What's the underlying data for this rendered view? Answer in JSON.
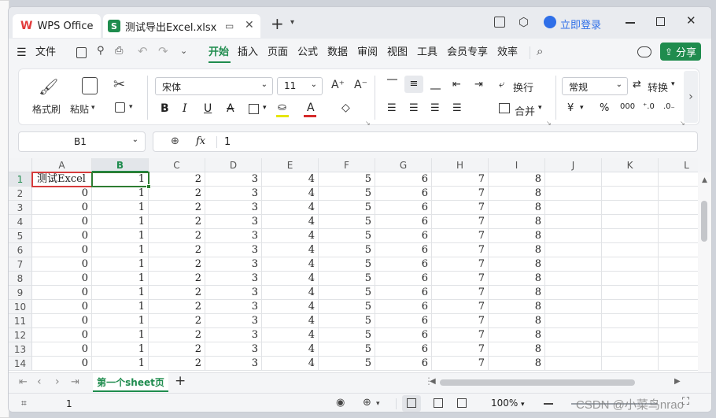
{
  "tabs": [
    {
      "label": "WPS Office"
    },
    {
      "label": "测试导出Excel.xlsx"
    }
  ],
  "window": {
    "login_label": "立即登录"
  },
  "menu": {
    "items": [
      "文件",
      "开始",
      "插入",
      "页面",
      "公式",
      "数据",
      "审阅",
      "视图",
      "工具",
      "会员专享",
      "效率"
    ],
    "active": "开始",
    "share_label": "分享"
  },
  "ribbon": {
    "format_painter": "格式刷",
    "paste": "粘贴",
    "font_name": "宋体",
    "font_size": "11",
    "wrap": "换行",
    "merge": "合并",
    "number_format": "常规",
    "convert": "转换",
    "bold": "B",
    "italic": "I",
    "underline": "U",
    "strike": "A",
    "percent": "%"
  },
  "formula_bar": {
    "cell_ref": "B1",
    "fx": "fx",
    "value": "1"
  },
  "columns": [
    "A",
    "B",
    "C",
    "D",
    "E",
    "F",
    "G",
    "H",
    "I",
    "J",
    "K",
    "L"
  ],
  "rows": [
    {
      "n": "1",
      "cells": [
        "测试Excel",
        "1",
        "2",
        "3",
        "4",
        "5",
        "6",
        "7",
        "8"
      ]
    },
    {
      "n": "2",
      "cells": [
        "0",
        "1",
        "2",
        "3",
        "4",
        "5",
        "6",
        "7",
        "8"
      ]
    },
    {
      "n": "3",
      "cells": [
        "0",
        "1",
        "2",
        "3",
        "4",
        "5",
        "6",
        "7",
        "8"
      ]
    },
    {
      "n": "4",
      "cells": [
        "0",
        "1",
        "2",
        "3",
        "4",
        "5",
        "6",
        "7",
        "8"
      ]
    },
    {
      "n": "5",
      "cells": [
        "0",
        "1",
        "2",
        "3",
        "4",
        "5",
        "6",
        "7",
        "8"
      ]
    },
    {
      "n": "6",
      "cells": [
        "0",
        "1",
        "2",
        "3",
        "4",
        "5",
        "6",
        "7",
        "8"
      ]
    },
    {
      "n": "7",
      "cells": [
        "0",
        "1",
        "2",
        "3",
        "4",
        "5",
        "6",
        "7",
        "8"
      ]
    },
    {
      "n": "8",
      "cells": [
        "0",
        "1",
        "2",
        "3",
        "4",
        "5",
        "6",
        "7",
        "8"
      ]
    },
    {
      "n": "9",
      "cells": [
        "0",
        "1",
        "2",
        "3",
        "4",
        "5",
        "6",
        "7",
        "8"
      ]
    },
    {
      "n": "10",
      "cells": [
        "0",
        "1",
        "2",
        "3",
        "4",
        "5",
        "6",
        "7",
        "8"
      ]
    },
    {
      "n": "11",
      "cells": [
        "0",
        "1",
        "2",
        "3",
        "4",
        "5",
        "6",
        "7",
        "8"
      ]
    },
    {
      "n": "12",
      "cells": [
        "0",
        "1",
        "2",
        "3",
        "4",
        "5",
        "6",
        "7",
        "8"
      ]
    },
    {
      "n": "13",
      "cells": [
        "0",
        "1",
        "2",
        "3",
        "4",
        "5",
        "6",
        "7",
        "8"
      ]
    },
    {
      "n": "14",
      "cells": [
        "0",
        "1",
        "2",
        "3",
        "4",
        "5",
        "6",
        "7",
        "8"
      ]
    }
  ],
  "sheet_tab": {
    "label": "第一个sheet页"
  },
  "status": {
    "value": "1",
    "zoom": "100%"
  },
  "watermark": "CSDN @小菜鸟nrao",
  "colors": {
    "accent": "#1f8c4e",
    "selected_border": "#2e7d32",
    "highlight_border": "#d63b3b"
  }
}
